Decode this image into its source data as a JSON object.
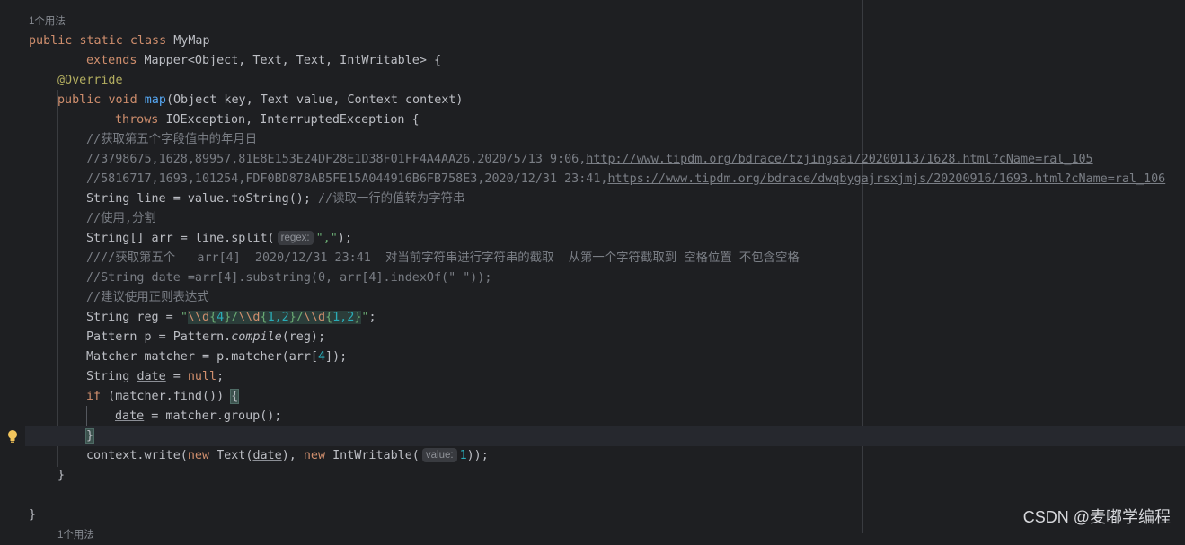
{
  "editor": {
    "usage_hint_top": "1个用法",
    "usage_hint_bottom": "1个用法",
    "code": {
      "class_decl": {
        "kw1": "public",
        "kw2": "static",
        "kw3": "class",
        "name": "MyMap"
      },
      "extends_line": {
        "kw": "extends",
        "rest": "Mapper<Object, Text, Text, IntWritable> {"
      },
      "annotation": "@Override",
      "method_decl": {
        "kw1": "public",
        "kw2": "void",
        "name": "map",
        "params": "(Object key, Text value, Context context)"
      },
      "throws_line": {
        "kw": "throws",
        "rest": "IOException, InterruptedException {"
      },
      "comment1": "//获取第五个字段值中的年月日",
      "comment2_text": "//3798675,1628,89957,81E8E153E24DF28E1D38F01FF4A4AA26,2020/5/13 9:06,",
      "comment2_link": "http://www.tipdm.org/bdrace/tzjingsai/20200113/1628.html?cName=ral_105",
      "comment3_text": "//5816717,1693,101254,FDF0BD878AB5FE15A044916B6FB758E3,2020/12/31 23:41,",
      "comment3_link": "https://www.tipdm.org/bdrace/dwqbygajrsxjmjs/20200916/1693.html?cName=ral_106",
      "line_tostring": {
        "code": "String line = value.toString(); ",
        "comment": "//读取一行的值转为字符串"
      },
      "comment4": "//使用,分割",
      "split_line": {
        "before": "String[] arr = line.split(",
        "hint": "regex:",
        "str": "\",\"",
        "after": ");"
      },
      "comment5": "////获取第五个   arr[4]  2020/12/31 23:41  对当前字符串进行字符串的截取  从第一个字符截取到 空格位置 不包含空格",
      "comment6": "//String date =arr[4].substring(0, arr[4].indexOf(\" \"));",
      "comment7": "//建议使用正则表达式",
      "reg_line": {
        "before": "String reg = ",
        "q1": "\"",
        "e1": "\\\\d",
        "b1o": "{",
        "n1": "4",
        "b1c": "}",
        "s1": "/",
        "e2": "\\\\d",
        "b2o": "{",
        "n2": "1,2",
        "b2c": "}",
        "s2": "/",
        "e3": "\\\\d",
        "b3o": "{",
        "n3": "1,2",
        "b3c": "}",
        "q2": "\"",
        "after": ";"
      },
      "pattern_line": {
        "before": "Pattern p = Pattern.",
        "method": "compile",
        "after": "(reg);"
      },
      "matcher_line": {
        "before": "Matcher matcher = p.matcher(arr[",
        "num": "4",
        "after": "]);"
      },
      "date_decl": {
        "type": "String ",
        "var": "date",
        "eq": " = ",
        "kw": "null",
        "end": ";"
      },
      "if_line": {
        "kw": "if",
        "rest": " (matcher.find()) ",
        "brace": "{"
      },
      "assign_line": {
        "var": "date",
        "rest": " = matcher.group();"
      },
      "close_brace": "}",
      "write_line": {
        "before": "context.write(",
        "kw1": "new",
        "mid1": " Text(",
        "var": "date",
        "mid2": "), ",
        "kw2": "new",
        "mid3": " IntWritable(",
        "hint": "value:",
        "num": "1",
        "after": "));"
      },
      "method_close": "}",
      "class_close": "}"
    }
  },
  "watermark": "CSDN @麦嘟学编程",
  "colors": {
    "background": "#1e1f22",
    "keyword": "#cf8e6d",
    "annotation": "#b3ae60",
    "function": "#56a8f5",
    "comment": "#7a7e85",
    "string": "#6aab73",
    "number": "#2aacb8"
  },
  "icons": {
    "gutter": "lightbulb-icon"
  }
}
